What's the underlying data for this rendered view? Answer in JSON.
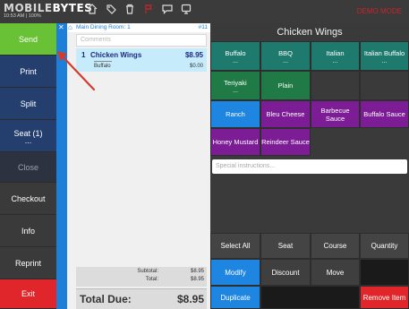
{
  "header": {
    "brand_part1": "MOBILE",
    "brand_part2": "BYTES",
    "status_line": "10:53 AM | 100% ",
    "right_label": "DEMO MODE",
    "icons": [
      "home-icon",
      "tag-icon",
      "trash-icon",
      "flag-icon",
      "chat-icon",
      "screen-icon"
    ]
  },
  "sidebar": {
    "send": "Send",
    "print": "Print",
    "split": "Split",
    "seat": "Seat (1)",
    "seat_dots": "...",
    "close": "Close",
    "checkout": "Checkout",
    "info": "Info",
    "reprint": "Reprint",
    "exit": "Exit"
  },
  "ticket": {
    "room": "Main Dining Room: 1",
    "number": "#11",
    "comments_placeholder": "Comments",
    "items": [
      {
        "qty": "1",
        "name": "Chicken Wings",
        "price": "$8.95",
        "modifier": "Buffalo",
        "modifier_price": "$0.00"
      }
    ],
    "subtotal_label": "Subtotal:",
    "subtotal_value": "$8.95",
    "total_label": "Total:",
    "total_value": "$8.95",
    "due_label": "Total Due:",
    "due_value": "$8.95"
  },
  "panel": {
    "title": "Chicken Wings",
    "modifiers": [
      {
        "label": "Buffalo",
        "dots": "...",
        "color": "#1f7a6e"
      },
      {
        "label": "BBQ",
        "dots": "...",
        "color": "#1f7a6e"
      },
      {
        "label": "Italian",
        "dots": "...",
        "color": "#1f7a6e"
      },
      {
        "label": "Italian Buffalo",
        "dots": "...",
        "color": "#1f7a6e"
      },
      {
        "label": "Teriyaki",
        "dots": "...",
        "color": "#1f7a45"
      },
      {
        "label": "Plain",
        "dots": "",
        "color": "#1f7a45"
      },
      {
        "label": "Ranch",
        "color": "#1e86e0"
      },
      {
        "label": "Bleu Cheese",
        "color": "#7c1d96"
      },
      {
        "label": "Barbecue Sauce",
        "color": "#7c1d96"
      },
      {
        "label": "Buffalo Sauce",
        "color": "#7c1d96"
      },
      {
        "label": "Honey Mustard",
        "color": "#7c1d96"
      },
      {
        "label": "Reindeer Sauce",
        "color": "#7c1d96"
      }
    ],
    "special_placeholder": "Special instructions...",
    "actions": {
      "select_all": "Select All",
      "seat": "Seat",
      "course": "Course",
      "quantity": "Quantity",
      "modify": "Modify",
      "discount": "Discount",
      "move": "Move",
      "duplicate": "Duplicate",
      "remove_item": "Remove Item"
    }
  },
  "colors": {
    "send_green": "#69c136",
    "sidebar_navy": "#243f6e",
    "accent_blue": "#1e7fd8",
    "exit_red": "#e0262a",
    "modifier_purple": "#7c1d96",
    "modifier_teal": "#1f7a6e"
  }
}
